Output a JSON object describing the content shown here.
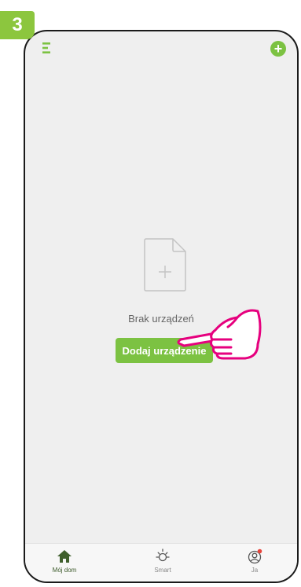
{
  "step": {
    "number": "3"
  },
  "header": {
    "menu_icon": "menu-icon",
    "add_icon": "plus-circle-icon",
    "accent_color": "#7cc242"
  },
  "main": {
    "empty_icon": "empty-document-plus-icon",
    "empty_text": "Brak urządzeń",
    "add_device_label": "Dodaj urządzenie",
    "pointer_icon": "pointing-hand-icon",
    "pointer_color": "#e6007e"
  },
  "tabbar": {
    "items": [
      {
        "label": "Mój dom",
        "icon": "home-icon",
        "active": true
      },
      {
        "label": "Smart",
        "icon": "sun-icon",
        "active": false
      },
      {
        "label": "Ja",
        "icon": "profile-icon",
        "active": false,
        "badge": true
      }
    ]
  }
}
